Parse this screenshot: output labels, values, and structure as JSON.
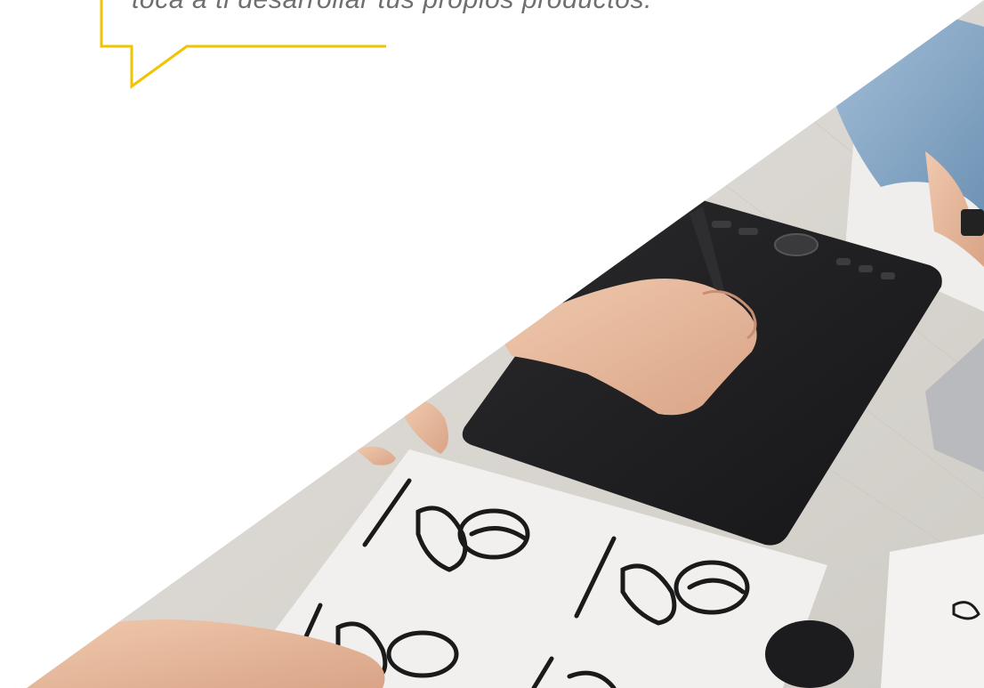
{
  "quote": {
    "text": "toca a ti desarrollar tus propios productos."
  },
  "photo": {
    "subject": "hands-drawing-on-graphic-tablet"
  },
  "colors": {
    "accent": "#f2c300",
    "quote_text": "#6f6f6f",
    "background": "#ffffff",
    "desk": "#d9d6d0",
    "tablet": "#1f1f22",
    "skin": "#e7b89d",
    "denim": "#8eaecb",
    "paper": "#f3f2f0",
    "ink": "#1a1a1a"
  },
  "icons": [
    "speech-bubble-icon"
  ]
}
